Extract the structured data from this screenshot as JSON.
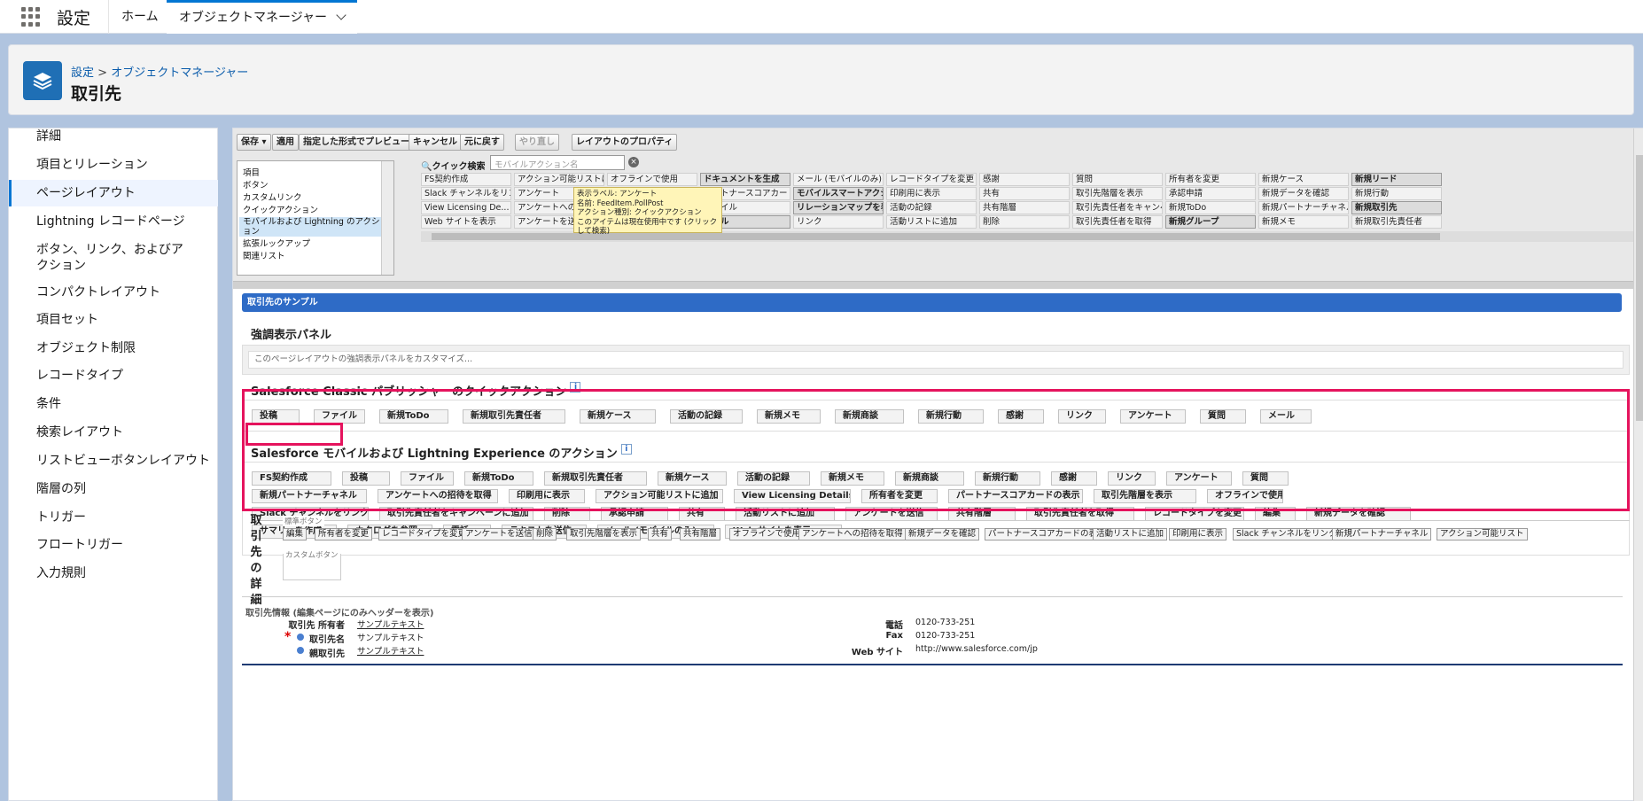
{
  "app": {
    "name": "設定",
    "tabs": {
      "home": "ホーム",
      "active": "オブジェクトマネージャー"
    }
  },
  "header": {
    "crumb_root": "設定",
    "crumb_sep": ">",
    "crumb_child": "オブジェクトマネージャー",
    "title": "取引先"
  },
  "sidebar": {
    "items": [
      "詳細",
      "項目とリレーション",
      "ページレイアウト",
      "Lightning レコードページ",
      "ボタン、リンク、およびアクション",
      "コンパクトレイアウト",
      "項目セット",
      "オブジェクト制限",
      "レコードタイプ",
      "条件",
      "検索レイアウト",
      "リストビューボタンレイアウト",
      "階層の列",
      "トリガー",
      "フロートリガー",
      "入力規則"
    ]
  },
  "toolbar": {
    "save": "保存 ▾",
    "apply": "適用",
    "preview": "指定した形式でプレビュー...▾",
    "cancel": "キャンセル",
    "undo": "元に戻す",
    "redo": "やり直し",
    "props": "レイアウトのプロパティ"
  },
  "palette": {
    "categories": [
      "項目",
      "ボタン",
      "カスタムリンク",
      "クイックアクション",
      "モバイルおよび Lightning のアクション",
      "拡張ルックアップ",
      "関連リスト"
    ],
    "search_label": "クイック検索",
    "search_placeholder": "モバイルアクション名",
    "rows": [
      [
        "FS契約作成",
        "アクション可能リストに追加",
        "オフラインで使用",
        "ドキュメントを生成",
        "メール (モバイルのみ)",
        "レコードタイプを変更",
        "感謝",
        "質問",
        "所有者を変更",
        "新規ケース",
        "新規リード"
      ],
      [
        "Slack チャンネルをリンク",
        "アンケート",
        "カタログを参照",
        "パートナースコアカードの表",
        "モバイルスマートアクション",
        "印刷用に表示",
        "共有",
        "取引先階層を表示",
        "承認申請",
        "新規データを確認",
        "新規行動"
      ],
      [
        "View Licensing De...",
        "アンケートへの招待を取得",
        "サマリーを作成",
        "ファイル",
        "リレーションマップを表示",
        "活動の記録",
        "共有階層",
        "取引先責任者をキャンペ",
        "新規ToDo",
        "新規パートナーチャネル",
        "新規取引先"
      ],
      [
        "Web サイトを表示",
        "アンケートを送信",
        "テキストを送信",
        "メール",
        "リンク",
        "活動リストに追加",
        "削除",
        "取引先責任者を取得",
        "新規グループ",
        "新規メモ",
        "新規取引先責任者"
      ]
    ],
    "tooltip": [
      "表示ラベル: アンケート",
      "名前: FeedItem.PollPost",
      "アクション種別: クイックアクション",
      "このアイテムは現在使用中です (クリックして検索)"
    ]
  },
  "layout": {
    "sample_header": "取引先のサンプル",
    "highlights_title": "強調表示パネル",
    "highlights_hint": "このページレイアウトの強調表示パネルをカスタマイズ...",
    "classic_title": "Salesforce Classic パブリッシャーのクイックアクション",
    "classic_actions": [
      "投稿",
      "ファイル",
      "新規ToDo",
      "新規取引先責任者",
      "新規ケース",
      "活動の記録",
      "新規メモ",
      "新規商談",
      "新規行動",
      "感謝",
      "リンク",
      "アンケート",
      "質問",
      "メール"
    ],
    "mobile_title": "Salesforce モバイルおよび Lightning Experience のアクション",
    "mobile_rows": [
      [
        "FS契約作成",
        "投稿",
        "ファイル",
        "新規ToDo",
        "新規取引先責任者",
        "新規ケース",
        "活動の記録",
        "新規メモ",
        "新規商談",
        "新規行動",
        "感謝",
        "リンク",
        "アンケート",
        "質問"
      ],
      [
        "新規パートナーチャネル",
        "アンケートへの招待を取得",
        "印刷用に表示",
        "アクション可能リストに追加",
        "View Licensing Details",
        "所有者を変更",
        "パートナースコアカードの表示",
        "取引先階層を表示",
        "オフラインで使用"
      ],
      [
        "Slack チャンネルをリンク",
        "取引先責任者をキャンペーンに追加",
        "削除",
        "承認申請",
        "共有",
        "活動リストに追加",
        "アンケートを送信",
        "共有階層",
        "取引先責任者を取得",
        "レコードタイプを変更",
        "編集",
        "新規データを確認"
      ],
      [
        "サマリーを作成",
        "カタログを参照",
        "電話",
        "テキストを送信",
        "メール (モバイルのみ)",
        "Web サイトを表示"
      ]
    ],
    "details_title": "取引先の詳細",
    "std_legend": "標準ボタン",
    "std_buttons": [
      "編集",
      "所有者を変更",
      "レコードタイプを変更",
      "アンケートを送信",
      "削除",
      "取引先階層を表示",
      "共有",
      "共有階層",
      "オフラインで使用",
      "アンケートへの招待を取得",
      "新規データを確認",
      "パートナースコアカードの表示",
      "活動リストに追加",
      "印刷用に表示",
      "Slack チャンネルをリンク",
      "新規パートナーチャネル",
      "アクション可能リスト"
    ],
    "custom_legend": "カスタムボタン",
    "field_section": "取引先情報 (編集ページにのみヘッダーを表示)",
    "fields_left": [
      {
        "label": "取引先 所有者",
        "value": "サンプルテキスト"
      },
      {
        "label": "取引先名",
        "value": "サンプルテキスト"
      },
      {
        "label": "親取引先",
        "value": "サンプルテキスト"
      }
    ],
    "fields_right": [
      {
        "label": "電話",
        "value": "0120-733-251"
      },
      {
        "label": "Fax",
        "value": "0120-733-251"
      },
      {
        "label": "Web サイト",
        "value": "http://www.salesforce.com/jp"
      }
    ]
  },
  "colors": {
    "accent": "#0176d3",
    "highlight": "#e5135d",
    "section_blue": "#2e6bc6"
  }
}
